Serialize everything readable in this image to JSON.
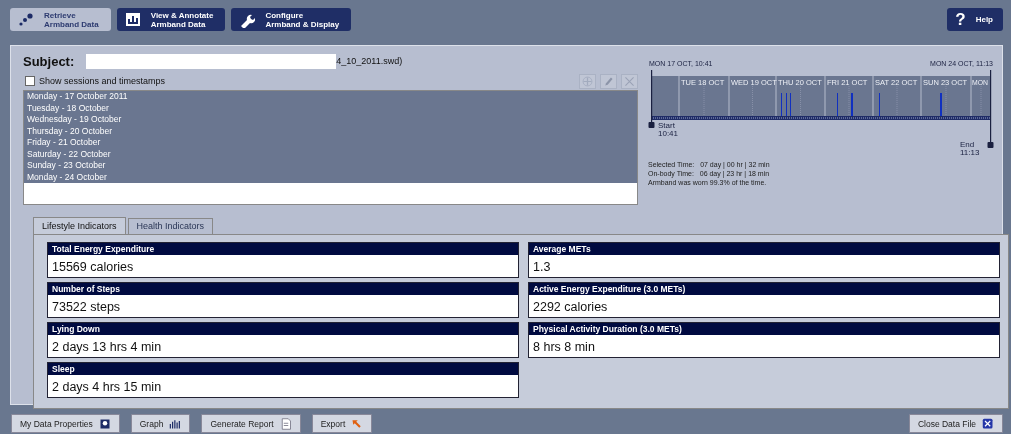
{
  "toolbar": {
    "buttons": [
      {
        "label": "Retrieve\nArmband Data",
        "selected": true
      },
      {
        "label": "View & Annotate\nArmband Data",
        "selected": false
      },
      {
        "label": "Configure\nArmband & Display",
        "selected": false
      }
    ],
    "help": {
      "icon": "?",
      "label": "Help"
    }
  },
  "subject": {
    "label": "Subject:",
    "value": "4_10_2011.swd)"
  },
  "show_sessions": {
    "label": "Show sessions and timestamps",
    "checked": false
  },
  "list_tools": [
    {
      "disabled": true
    },
    {
      "disabled": true
    },
    {
      "disabled": true
    }
  ],
  "days": [
    {
      "label": "Monday - 17 October 2011",
      "selected": true
    },
    {
      "label": "Tuesday - 18 October",
      "selected": true
    },
    {
      "label": "Wednesday - 19 October",
      "selected": true
    },
    {
      "label": "Thursday - 20 October",
      "selected": true
    },
    {
      "label": "Friday - 21 October",
      "selected": true
    },
    {
      "label": "Saturday - 22 October",
      "selected": true
    },
    {
      "label": "Sunday - 23 October",
      "selected": true
    },
    {
      "label": "Monday - 24 October",
      "selected": true
    }
  ],
  "timeline": {
    "start_header": "MON 17 OCT, 10:41",
    "end_header": "MON 24 OCT, 11:13",
    "day_labels": [
      "TUE 18 OCT",
      "WED 19 OCT",
      "THU 20 OCT",
      "FRI 21 OCT",
      "SAT 22 OCT",
      "SUN 23 OCT",
      "MON"
    ],
    "start_label": "Start",
    "start_time": "10:41",
    "end_label": "End",
    "end_time": "11:13"
  },
  "summary": [
    {
      "label": "Selected Time:",
      "value": "07 day | 00 hr | 32 min"
    },
    {
      "label": "On-body Time:",
      "value": "06 day | 23 hr | 18 min"
    }
  ],
  "note": "Armband was worn 99.3% of the time.",
  "tabs": [
    {
      "label": "Lifestyle Indicators",
      "selected": true
    },
    {
      "label": "Health Indicators",
      "selected": false
    }
  ],
  "indicators": [
    {
      "title": "Total Energy Expenditure",
      "value": "15569 calories"
    },
    {
      "title": "Average METs",
      "value": "1.3"
    },
    {
      "title": "Number of Steps",
      "value": "73522 steps"
    },
    {
      "title": "Active Energy Expenditure (3.0 METs)",
      "value": "2292 calories"
    },
    {
      "title": "Lying Down",
      "value": "2 days 13 hrs 4 min"
    },
    {
      "title": "Physical Activity Duration (3.0 METs)",
      "value": "8 hrs 8 min"
    },
    {
      "title": "Sleep",
      "value": "2 days 4 hrs 15 min"
    }
  ],
  "footer": {
    "buttons": [
      {
        "label": "My Data Properties"
      },
      {
        "label": "Graph"
      },
      {
        "label": "Generate Report"
      },
      {
        "label": "Export"
      }
    ],
    "close": {
      "label": "Close Data File"
    }
  }
}
